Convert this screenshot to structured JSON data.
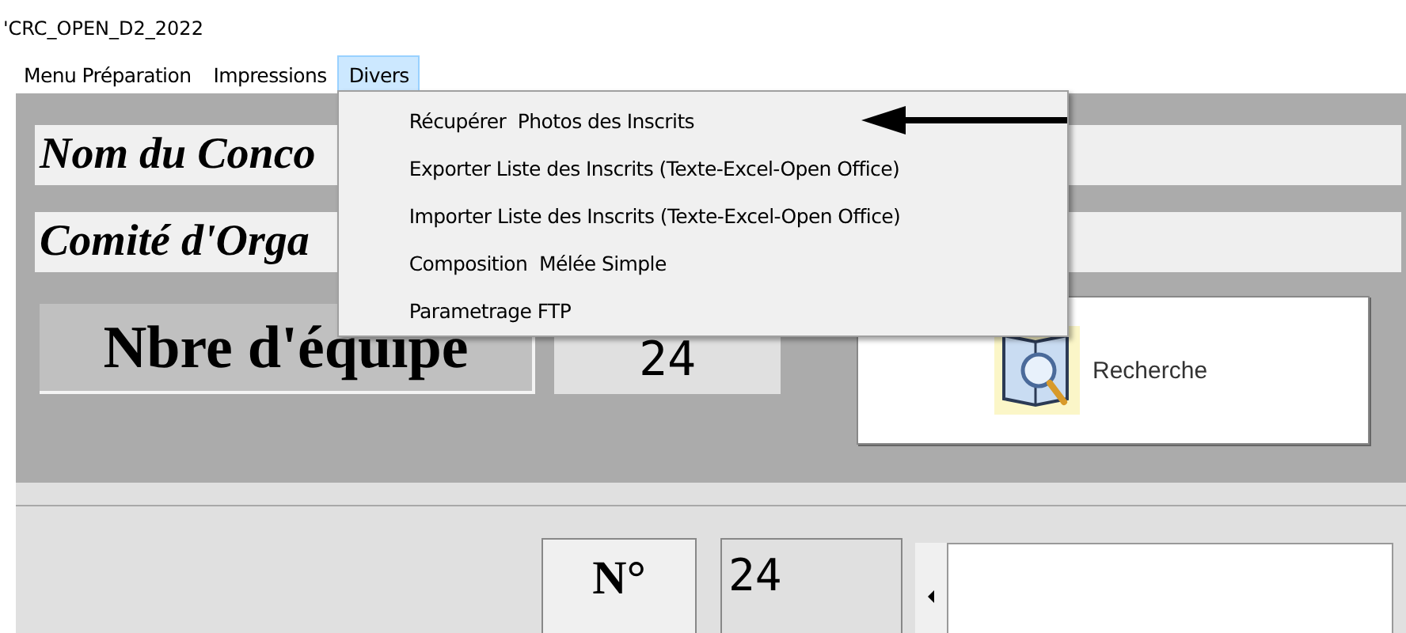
{
  "window": {
    "title": "'CRC_OPEN_D2_2022"
  },
  "menu_bar": [
    {
      "label": "Menu Préparation",
      "selected": false
    },
    {
      "label": "Impressions",
      "selected": false
    },
    {
      "label": "Divers",
      "selected": true
    }
  ],
  "dropdown": {
    "items": [
      {
        "label": "Récupérer  Photos des Inscrits"
      },
      {
        "label": "Exporter Liste des Inscrits (Texte-Excel-Open Office)"
      },
      {
        "label": "Importer Liste des Inscrits (Texte-Excel-Open Office)"
      },
      {
        "label": "Composition  Mélée Simple"
      },
      {
        "label": "Parametrage FTP"
      }
    ]
  },
  "form": {
    "competition_label": "Nom du Conco",
    "committee_label": "Comité d'Orga",
    "teams_label": "Nbre d'équipe",
    "teams_value": "24",
    "search_button": "Recherche"
  },
  "record": {
    "number_label": "N°",
    "number_value": "24"
  }
}
